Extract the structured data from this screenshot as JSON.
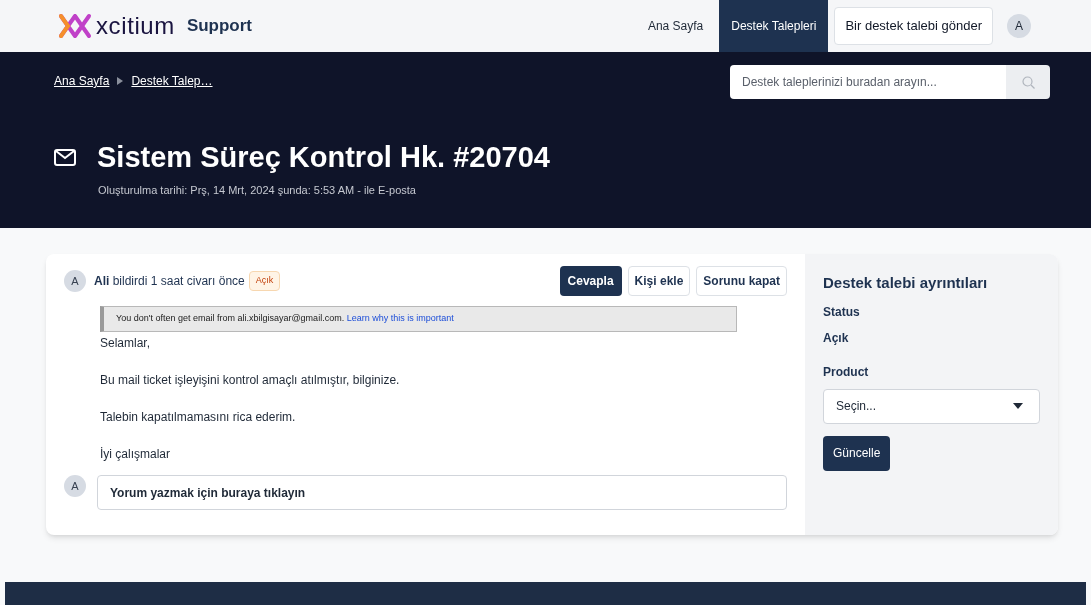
{
  "header": {
    "logo_text": "xcitium",
    "logo_suffix": "Support",
    "nav": [
      {
        "label": "Ana Sayfa",
        "selected": false
      },
      {
        "label": "Destek Talepleri",
        "selected": true
      }
    ],
    "submit_button": "Bir destek talebi gönder",
    "avatar": "A"
  },
  "banner": {
    "breadcrumbs": [
      "Ana Sayfa",
      "Destek Talep…"
    ],
    "search": {
      "placeholder": "Destek taleplerinizi buradan arayın..."
    },
    "title": "Sistem Süreç Kontrol Hk. #20704",
    "subtitle": "Oluşturulma tarihi: Prş, 14 Mrt, 2024 şunda: 5:53 AM - ile E-posta"
  },
  "message": {
    "avatar": "A",
    "byline": "**Ali** bildirdi 1 saat civarı önce",
    "status_badge": "Açık",
    "actions": [
      {
        "label": "Cevapla",
        "primary": true
      },
      {
        "label": "Kişi ekle",
        "primary": false
      },
      {
        "label": "Sorunu kapat",
        "primary": false
      }
    ],
    "warning": {
      "text": "You don't often get email from ali.xbilgisayar@gmail.com.",
      "link": "Learn why this is important"
    },
    "paragraphs": [
      "Selamlar,",
      "Bu mail ticket işleyişini kontrol amaçlı atılmıştır, bilginize.",
      "Talebin kapatılmamasını rica ederim.",
      "İyi çalışmalar"
    ],
    "comment": {
      "avatar": "A",
      "placeholder": "Yorum yazmak için buraya tıklayın"
    }
  },
  "details": {
    "title": "Destek talebi ayrıntıları",
    "status_label": "Status",
    "status_value": "Açık",
    "product_label": "Product",
    "product_select": "Seçin...",
    "update_button": "Güncelle"
  }
}
